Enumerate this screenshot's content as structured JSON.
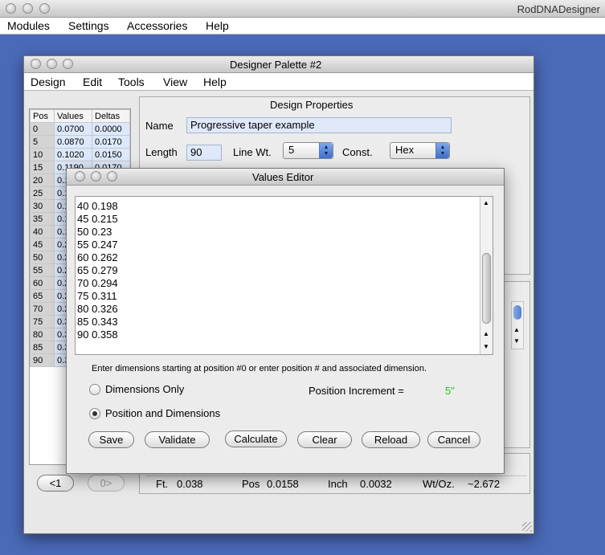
{
  "app": {
    "title": "RodDNADesigner",
    "menu": [
      "Modules",
      "Settings",
      "Accessories",
      "Help"
    ]
  },
  "palette": {
    "title": "Designer Palette #2",
    "menu": [
      "Design",
      "Edit",
      "Tools",
      "View",
      "Help"
    ],
    "table": {
      "headers": [
        "Pos",
        "Values",
        "Deltas"
      ],
      "rows": [
        [
          "0",
          "0.0700",
          "0.0000"
        ],
        [
          "5",
          "0.0870",
          "0.0170"
        ],
        [
          "10",
          "0.1020",
          "0.0150"
        ],
        [
          "15",
          "0.1190",
          "0.0170"
        ],
        [
          "20",
          "0.1",
          ""
        ],
        [
          "25",
          "0.1",
          ""
        ],
        [
          "30",
          "0.1",
          ""
        ],
        [
          "35",
          "0.1",
          ""
        ],
        [
          "40",
          "0.1",
          ""
        ],
        [
          "45",
          "0.2",
          ""
        ],
        [
          "50",
          "0.2",
          ""
        ],
        [
          "55",
          "0.2",
          ""
        ],
        [
          "60",
          "0.2",
          ""
        ],
        [
          "65",
          "0.2",
          ""
        ],
        [
          "70",
          "0.2",
          ""
        ],
        [
          "75",
          "0.3",
          ""
        ],
        [
          "80",
          "0.3",
          ""
        ],
        [
          "85",
          "0.3",
          ""
        ],
        [
          "90",
          "0.3",
          ""
        ]
      ]
    },
    "design_properties": {
      "heading": "Design Properties",
      "name_label": "Name",
      "name_value": "Progressive taper example",
      "length_label": "Length",
      "length_value": "90",
      "line_wt_label": "Line Wt.",
      "line_wt_value": "5",
      "const_label": "Const.",
      "const_value": "Hex"
    },
    "nav": {
      "prev": "<1",
      "next": "0>"
    },
    "status": {
      "ft_label": "Ft.",
      "ft_value": "0.038",
      "pos_label": "Pos",
      "pos_value": "0.0158",
      "inch_label": "Inch",
      "inch_value": "0.0032",
      "wt_label": "Wt/Oz.",
      "wt_value": "~2.672"
    }
  },
  "values_editor": {
    "title": "Values Editor",
    "lines": [
      "40 0.198",
      "45 0.215",
      "50 0.23",
      "55 0.247",
      "60 0.262",
      "65 0.279",
      "70 0.294",
      "75 0.311",
      "80 0.326",
      "85 0.343",
      "90 0.358"
    ],
    "instructions": "Enter dimensions starting at position #0 or enter position # and associated dimension.",
    "radio_dimensions_only": "Dimensions Only",
    "radio_position_dimensions": "Position and Dimensions",
    "selected_mode": "Position and Dimensions",
    "position_increment_label": "Position Increment =",
    "position_increment_value": "5\"",
    "increment_color": "#22c522",
    "buttons": {
      "save": "Save",
      "validate": "Validate",
      "calculate": "Calculate",
      "clear": "Clear",
      "reload": "Reload",
      "cancel": "Cancel"
    }
  }
}
